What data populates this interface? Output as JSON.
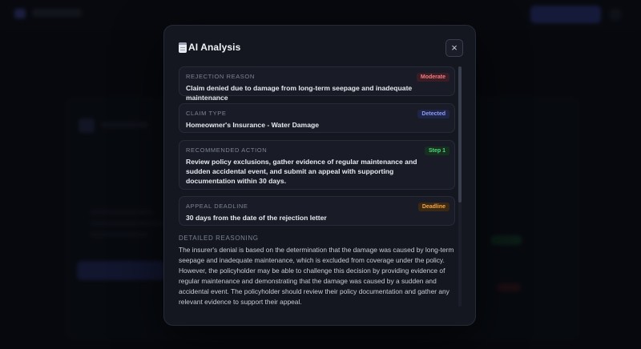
{
  "modal": {
    "title": "AI Analysis",
    "close_label": "×",
    "fields": [
      {
        "label": "REJECTION REASON",
        "badge": "Moderate",
        "value": "Claim denied due to damage from long-term seepage and inadequate maintenance"
      },
      {
        "label": "CLAIM TYPE",
        "badge": "Detected",
        "value": "Homeowner's Insurance - Water Damage"
      },
      {
        "label": "RECOMMENDED ACTION",
        "badge": "Step 1",
        "value": "Review policy exclusions, gather evidence of regular maintenance and sudden accidental event, and submit an appeal with supporting documentation within 30 days."
      },
      {
        "label": "APPEAL DEADLINE",
        "badge": "Deadline",
        "value": "30 days from the date of the rejection letter"
      }
    ],
    "reasoning_title": "DETAILED REASONING",
    "reasoning_text": "The insurer's denial is based on the determination that the damage was caused by long-term seepage and inadequate maintenance, which is excluded from coverage under the policy. However, the policyholder may be able to challenge this decision by providing evidence of regular maintenance and demonstrating that the damage was caused by a sudden and accidental event. The policyholder should review their policy documentation and gather any relevant evidence to support their appeal."
  },
  "icons": {
    "title_icon": "clipboard-icon",
    "close_icon": "close-icon"
  },
  "colors": {
    "modal_bg": "#141720",
    "moderate": "#f07b82",
    "detected": "#8f9cf5",
    "step": "#55d47e",
    "deadline": "#f3a64a"
  }
}
